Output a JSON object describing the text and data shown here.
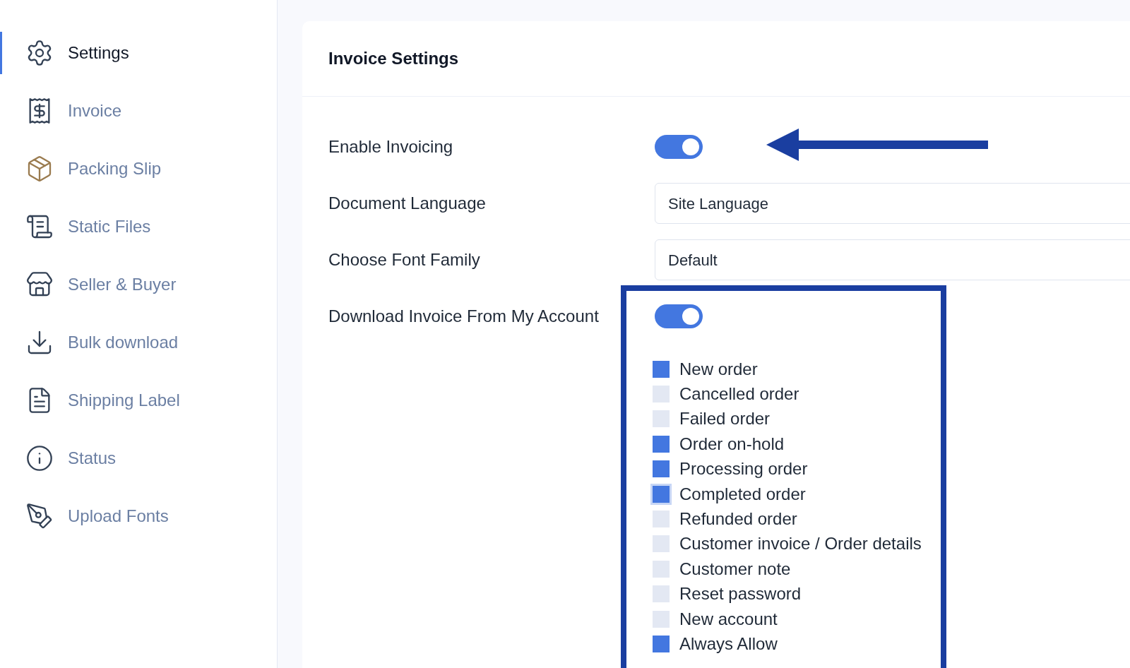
{
  "sidebar": {
    "items": [
      {
        "label": "Settings",
        "selected": true
      },
      {
        "label": "Invoice",
        "selected": false
      },
      {
        "label": "Packing Slip",
        "selected": false
      },
      {
        "label": "Static Files",
        "selected": false
      },
      {
        "label": "Seller & Buyer",
        "selected": false
      },
      {
        "label": "Bulk download",
        "selected": false
      },
      {
        "label": "Shipping Label",
        "selected": false
      },
      {
        "label": "Status",
        "selected": false
      },
      {
        "label": "Upload Fonts",
        "selected": false
      }
    ]
  },
  "panel": {
    "title": "Invoice Settings",
    "settings": [
      {
        "kind": "toggle",
        "label": "Enable Invoicing",
        "on": true
      },
      {
        "kind": "select",
        "label": "Document Language",
        "value": "Site Language"
      },
      {
        "kind": "select",
        "label": "Choose Font Family",
        "value": "Default"
      },
      {
        "kind": "toggle",
        "label": "Download Invoice From My Account",
        "on": true,
        "options": [
          {
            "label": "New order",
            "checked": true,
            "focused": false
          },
          {
            "label": "Cancelled order",
            "checked": false,
            "focused": false
          },
          {
            "label": "Failed order",
            "checked": false,
            "focused": false
          },
          {
            "label": "Order on-hold",
            "checked": true,
            "focused": false
          },
          {
            "label": "Processing order",
            "checked": true,
            "focused": false
          },
          {
            "label": "Completed order",
            "checked": true,
            "focused": true
          },
          {
            "label": "Refunded order",
            "checked": false,
            "focused": false
          },
          {
            "label": "Customer invoice / Order details",
            "checked": false,
            "focused": false
          },
          {
            "label": "Customer note",
            "checked": false,
            "focused": false
          },
          {
            "label": "Reset password",
            "checked": false,
            "focused": false
          },
          {
            "label": "New account",
            "checked": false,
            "focused": false
          },
          {
            "label": "Always Allow",
            "checked": true,
            "focused": false
          }
        ]
      }
    ]
  }
}
